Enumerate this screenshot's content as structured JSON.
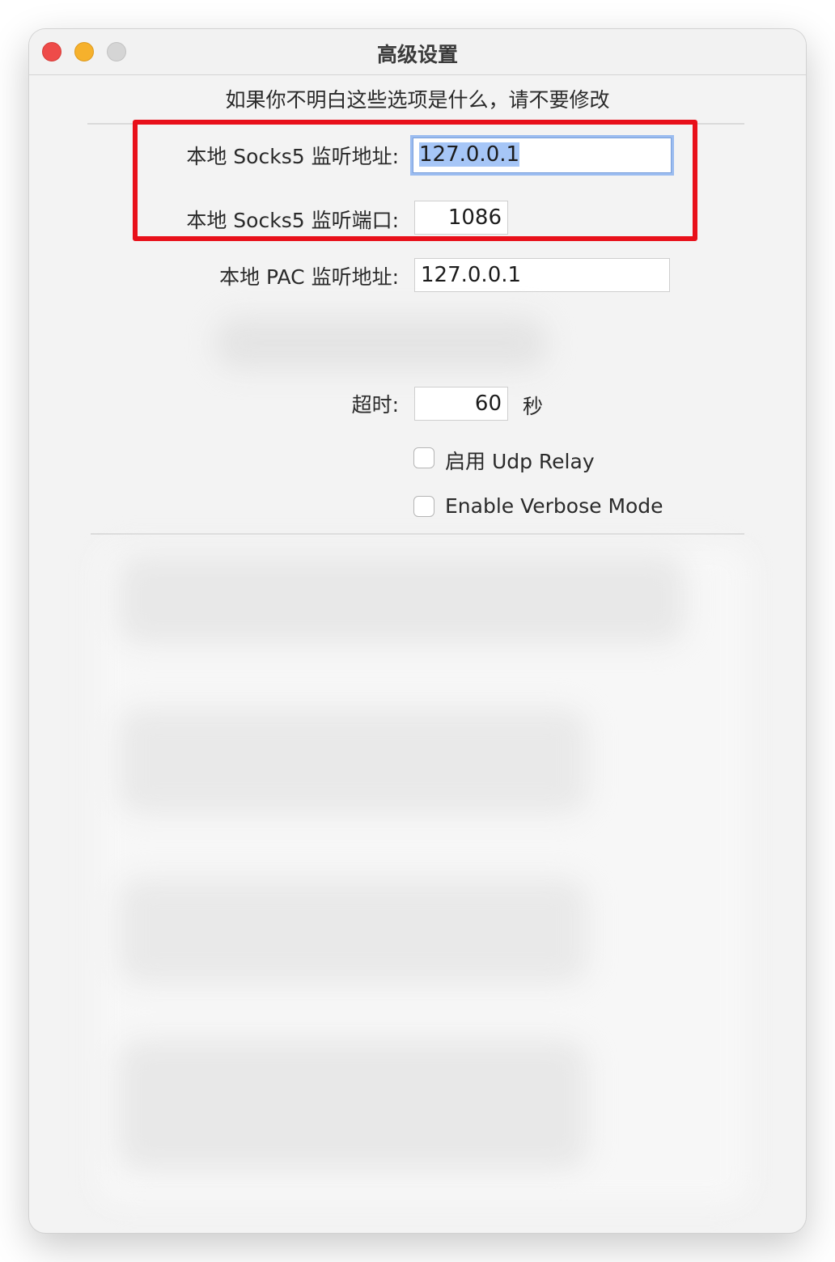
{
  "window": {
    "title": "高级设置",
    "warning": "如果你不明白这些选项是什么，请不要修改"
  },
  "socks5_address": {
    "label": "本地 Socks5 监听地址:",
    "value": "127.0.0.1"
  },
  "socks5_port": {
    "label": "本地 Socks5 监听端口:",
    "value": "1086"
  },
  "pac_address": {
    "label": "本地 PAC 监听地址:",
    "value": "127.0.0.1"
  },
  "timeout": {
    "label": "超时:",
    "value": "60",
    "unit": "秒"
  },
  "checkboxes": [
    {
      "label": "启用 Udp Relay",
      "checked": false
    },
    {
      "label": "Enable Verbose Mode",
      "checked": false
    }
  ],
  "colors": {
    "annotation_box": "#e8101a",
    "focus_ring": "#9bbcf0",
    "close": "#ee4b49",
    "minimize": "#f6b12c",
    "zoom": "#d5d5d5"
  }
}
